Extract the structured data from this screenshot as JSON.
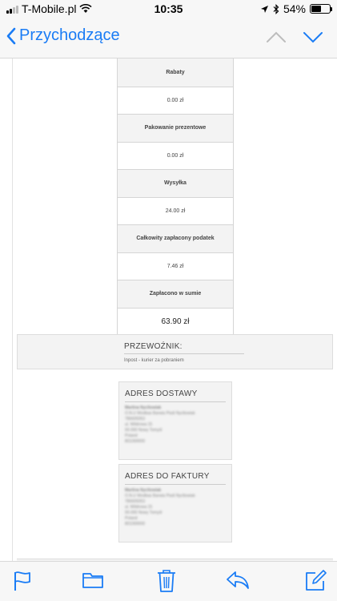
{
  "status_bar": {
    "carrier": "T-Mobile.pl",
    "time": "10:35",
    "battery_percent": "54%",
    "battery_level": 0.54
  },
  "nav": {
    "back_label": "Przychodzące"
  },
  "summary_table": [
    {
      "label": "Rabaty",
      "value": "0.00 zł"
    },
    {
      "label": "Pakowanie prezentowe",
      "value": "0.00 zł"
    },
    {
      "label": "Wysyłka",
      "value": "24.00 zł"
    },
    {
      "label": "Całkowity zapłacony podatek",
      "value": "7.46 zł"
    },
    {
      "label": "Zapłacono w sumie",
      "value": "63.90 zł"
    }
  ],
  "carrier": {
    "title": "PRZEWOŹNIK:",
    "text": "Inpost - kurier za pobraniem"
  },
  "shipping_address": {
    "title": "ADRES DOSTAWY",
    "lines": [
      "Martina Nycltowiak",
      "O.N.U Wodbas Barwia Pisdi Nycltowiak",
      "786609353",
      "ul. Wildrowa 15",
      "00-000 Nowy Tomyśl",
      "Poland",
      "801000000"
    ]
  },
  "billing_address": {
    "title": "ADRES DO FAKTURY",
    "lines": [
      "Martina Nycltowiak",
      "O.N.U Wodbas Barwia Pisdi Nycltowiak",
      "786609353",
      "ul. Wildrowa 15",
      "00-000 Nowy Tomyśl",
      "Poland",
      "801000000"
    ]
  },
  "colors": {
    "accent": "#1a7cf5"
  },
  "toolbar_icons": [
    "flag-icon",
    "folder-icon",
    "trash-icon",
    "reply-icon",
    "compose-icon"
  ]
}
